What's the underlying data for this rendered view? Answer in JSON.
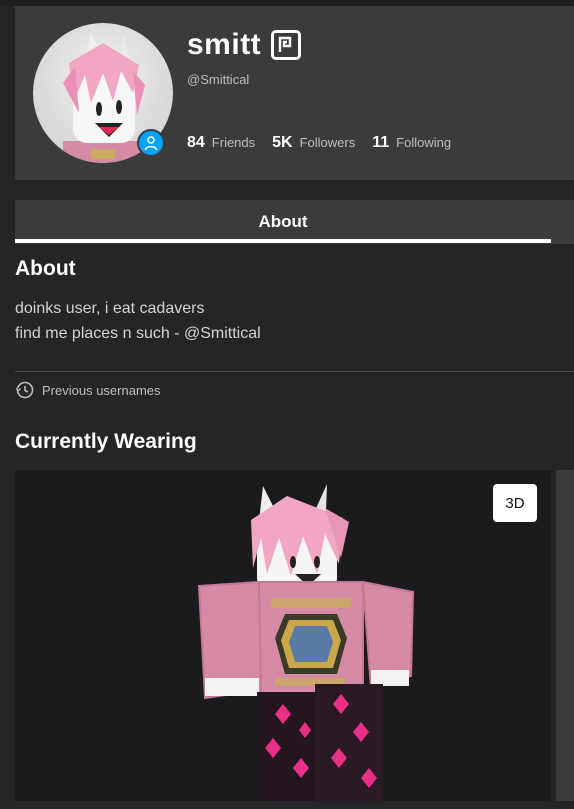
{
  "profile": {
    "display_name": "smitt",
    "username": "@Smittical",
    "stats": [
      {
        "value": "84",
        "label": "Friends"
      },
      {
        "value": "5K",
        "label": "Followers"
      },
      {
        "value": "11",
        "label": "Following"
      }
    ]
  },
  "tabs": [
    {
      "label": "About",
      "active": true
    }
  ],
  "about": {
    "title": "About",
    "lines": [
      "doinks user, i eat cadavers",
      "find me places n such - @Smittical"
    ],
    "previous_usernames_label": "Previous usernames"
  },
  "wearing": {
    "title": "Currently Wearing",
    "button_3d": "3D"
  },
  "colors": {
    "background": "#232527",
    "card": "#393b3d",
    "online_badge": "#00a2ff",
    "shirt": "#d58aa5",
    "hair": "#f1a6c6"
  },
  "icons": [
    "verified-badge-icon",
    "online-user-icon",
    "history-icon"
  ]
}
